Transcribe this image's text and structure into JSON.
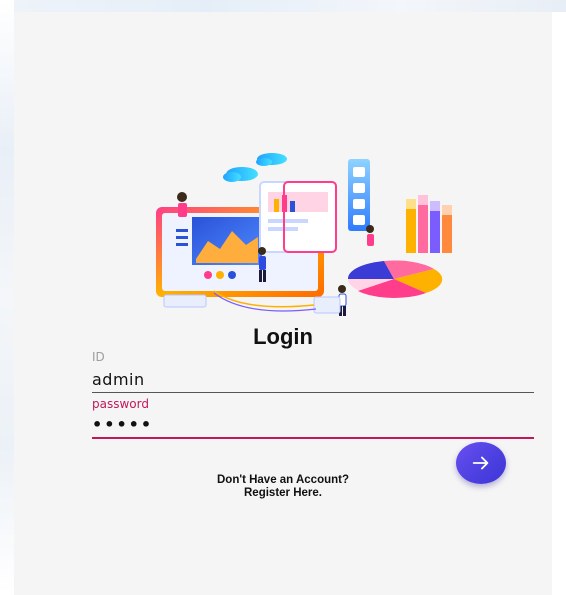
{
  "login": {
    "title": "Login",
    "id_label": "ID",
    "id_value": "admin",
    "password_label": "password",
    "password_value": "•••••",
    "submit_icon": "arrow-right-icon",
    "register_line1": "Don't Have an Account?",
    "register_line2": "Register Here."
  },
  "colors": {
    "accent": "#c2185b",
    "fab": "#4b3fe0",
    "background": "#f5f5f5"
  },
  "illustration": {
    "icon": "analytics-dashboard-illustration"
  }
}
